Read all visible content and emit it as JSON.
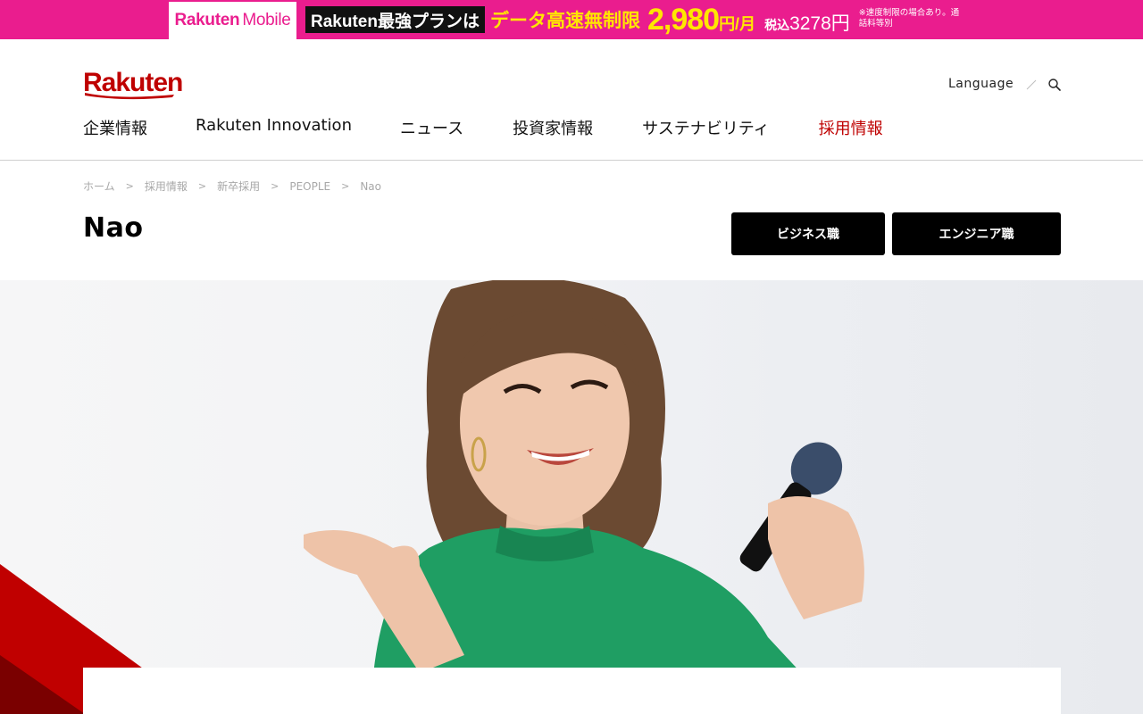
{
  "promo": {
    "brand_bold": "Rakuten",
    "brand_thin": "Mobile",
    "plan_label": "Rakuten最強プランは",
    "headline": "データ高速無制限",
    "price": "2,980",
    "unit": "円/月",
    "tax_label": "税込",
    "tax_price": "3278円",
    "note": "※速度制限の場合あり。通話料等別"
  },
  "header": {
    "logo": "Rakuten",
    "language": "Language",
    "search_icon": "search-icon",
    "nav": [
      {
        "label": "企業情報",
        "active": false
      },
      {
        "label": "Rakuten Innovation",
        "active": false
      },
      {
        "label": "ニュース",
        "active": false
      },
      {
        "label": "投資家情報",
        "active": false
      },
      {
        "label": "サステナビリティ",
        "active": false
      },
      {
        "label": "採用情報",
        "active": true
      }
    ]
  },
  "breadcrumb": [
    "ホーム",
    "採用情報",
    "新卒採用",
    "PEOPLE",
    "Nao"
  ],
  "page": {
    "title": "Nao",
    "buttons": {
      "business": "ビジネス職",
      "engineer": "エンジニア職"
    }
  },
  "colors": {
    "brand_red": "#bf0000",
    "promo_pink": "#ea1d8e",
    "promo_yellow": "#ffe600",
    "button_black": "#000000",
    "sweater_green": "#1f9e63"
  }
}
